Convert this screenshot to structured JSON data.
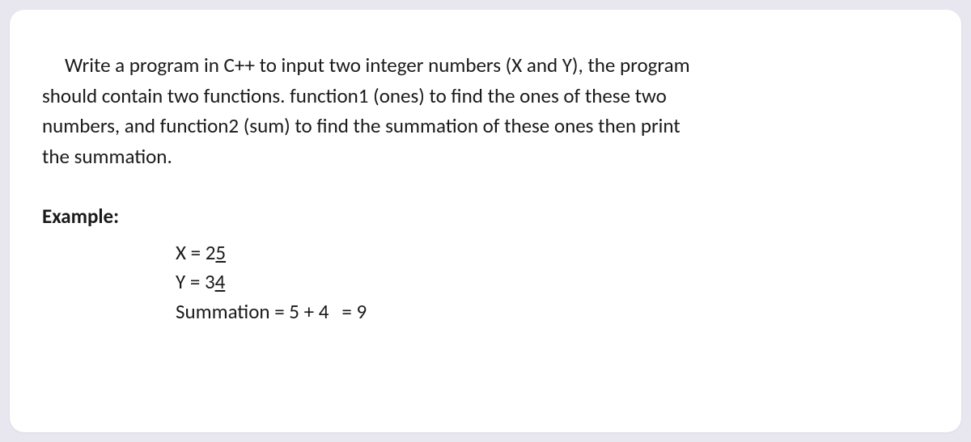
{
  "prompt": {
    "line1_indent": "Write a program in C++ to input two integer numbers (X and Y), the program",
    "line2": "should contain two functions. function1 (ones) to find the ones of these two",
    "line3": "numbers, and function2 (sum) to find the summation of these ones then print",
    "line4": "the summation."
  },
  "example": {
    "label": "Example:",
    "x_prefix": "X = 2",
    "x_ones": "5",
    "y_prefix": "Y = 3",
    "y_ones": "4",
    "sum_prefix": "Summation = 5 + 4",
    "sum_eq": "= 9"
  }
}
